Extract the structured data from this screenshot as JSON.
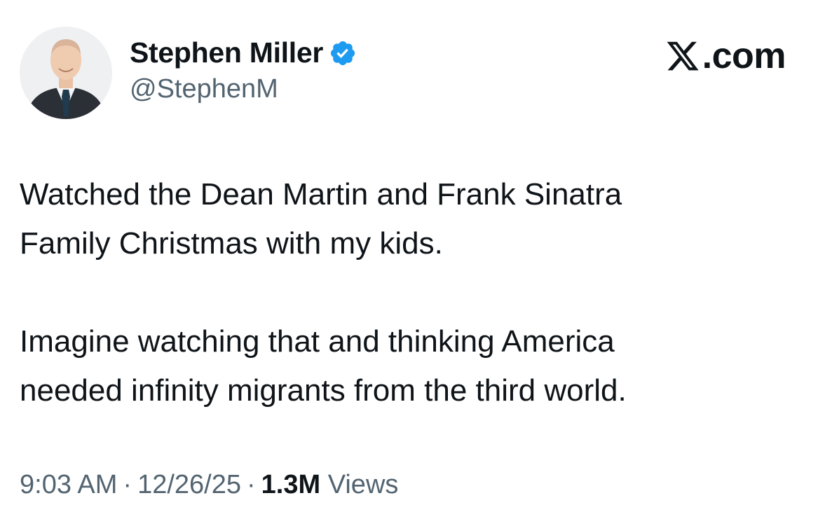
{
  "author": {
    "display_name": "Stephen Miller",
    "handle": "@StephenM",
    "verified": true,
    "verified_color": "#1d9bf0"
  },
  "brand": {
    "label": ".com",
    "icon": "x-logo-icon"
  },
  "tweet": {
    "paragraph1_lines": [
      "Watched the Dean Martin and Frank Sinatra",
      "Family Christmas with my kids."
    ],
    "paragraph2_lines": [
      "Imagine watching that and thinking America",
      "needed infinity migrants from the third world."
    ]
  },
  "meta": {
    "time": "9:03 AM",
    "separator": "·",
    "date": "12/26/25",
    "views_count": "1.3M",
    "views_label": "Views"
  },
  "colors": {
    "text_primary": "#0f1419",
    "text_secondary": "#536471"
  }
}
